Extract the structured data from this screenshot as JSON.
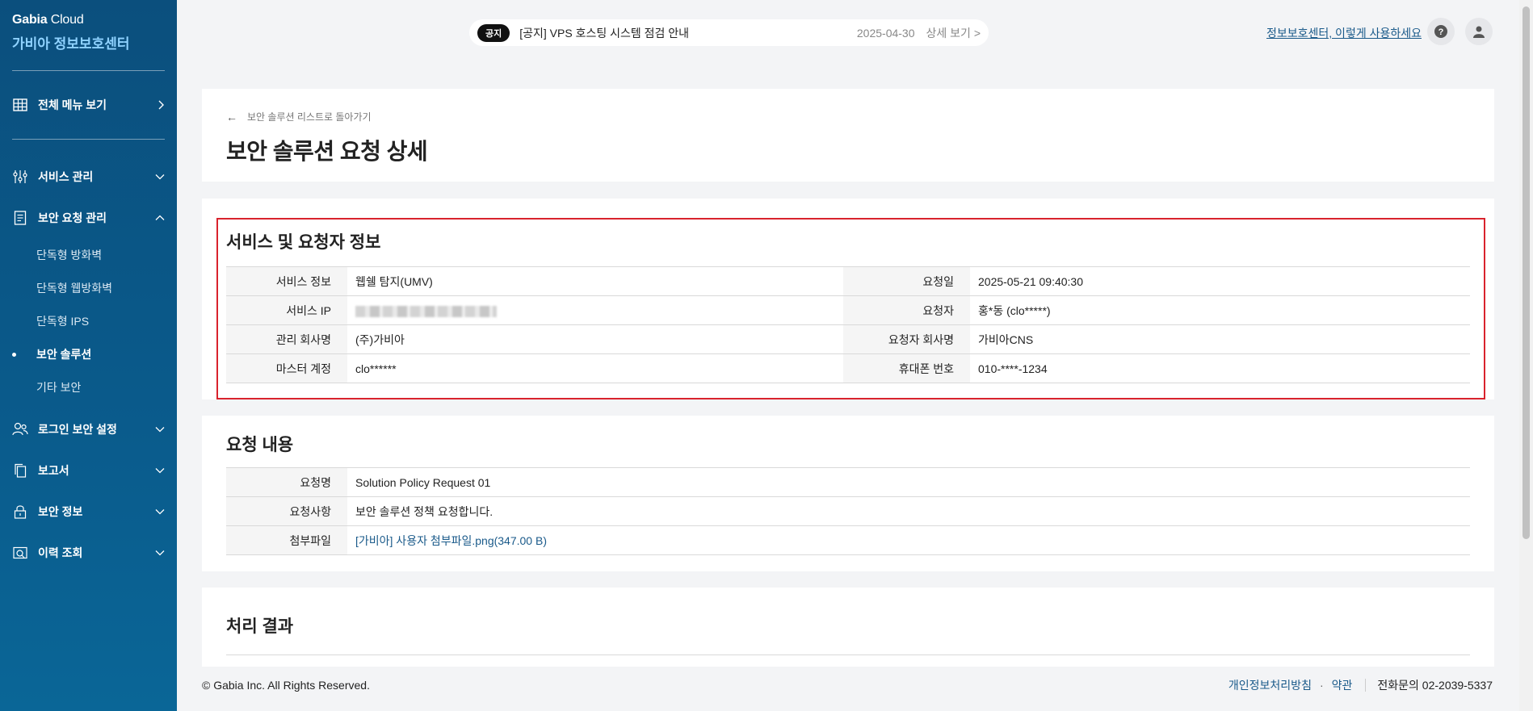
{
  "brand": {
    "top_bold": "Gabia",
    "top_light": "Cloud",
    "sub": "가비아 정보보호센터"
  },
  "sidebar": {
    "all_menu": "전체 메뉴 보기",
    "items": [
      {
        "label": "서비스 관리",
        "icon": "sliders-icon"
      },
      {
        "label": "보안 요청 관리",
        "icon": "document-icon",
        "sub": [
          "단독형 방화벽",
          "단독형 웹방화벽",
          "단독형 IPS",
          "보안 솔루션",
          "기타 보안"
        ],
        "active_sub": "보안 솔루션"
      },
      {
        "label": "로그인 보안 설정",
        "icon": "users-icon"
      },
      {
        "label": "보고서",
        "icon": "copy-icon"
      },
      {
        "label": "보안 정보",
        "icon": "lock-icon"
      },
      {
        "label": "이력 조회",
        "icon": "history-icon"
      }
    ]
  },
  "notice": {
    "badge": "공지",
    "title": "[공지] VPS 호스팅 시스템 점검 안내",
    "date": "2025-04-30",
    "more": "상세 보기 >"
  },
  "top": {
    "guide_link": "정보보호센터, 이렇게 사용하세요"
  },
  "header": {
    "back": "보안 솔루션 리스트로 돌아가기",
    "title": "보안 솔루션 요청 상세"
  },
  "info": {
    "title": "서비스 및 요청자 정보",
    "rows": [
      {
        "l1": "서비스 정보",
        "v1": "웹쉘 탐지(UMV)",
        "l2": "요청일",
        "v2": "2025-05-21 09:40:30"
      },
      {
        "l1": "서비스 IP",
        "v1": "",
        "l2": "요청자",
        "v2": "홍*동 (clo*****)"
      },
      {
        "l1": "관리 회사명",
        "v1": "(주)가비아",
        "l2": "요청자 회사명",
        "v2": "가비아CNS"
      },
      {
        "l1": "마스터 계정",
        "v1": "clo******",
        "l2": "휴대폰 번호",
        "v2": "010-****-1234"
      }
    ]
  },
  "request": {
    "title": "요청 내용",
    "name_label": "요청명",
    "name": "Solution Policy Request 01",
    "detail_label": "요청사항",
    "detail": "보안 솔루션 정책 요청합니다.",
    "file_label": "첨부파일",
    "file": "[가비아] 사용자 첨부파일.png(347.00 B)"
  },
  "result": {
    "title": "처리 결과"
  },
  "footer": {
    "copyright": "© Gabia Inc. All Rights Reserved.",
    "privacy": "개인정보처리방침",
    "terms": "약관",
    "phone": "전화문의 02-2039-5337"
  },
  "colors": {
    "sidebar": "#0b4f7d",
    "accent_link": "#1a5a8a",
    "highlight_border": "#d9232d"
  }
}
